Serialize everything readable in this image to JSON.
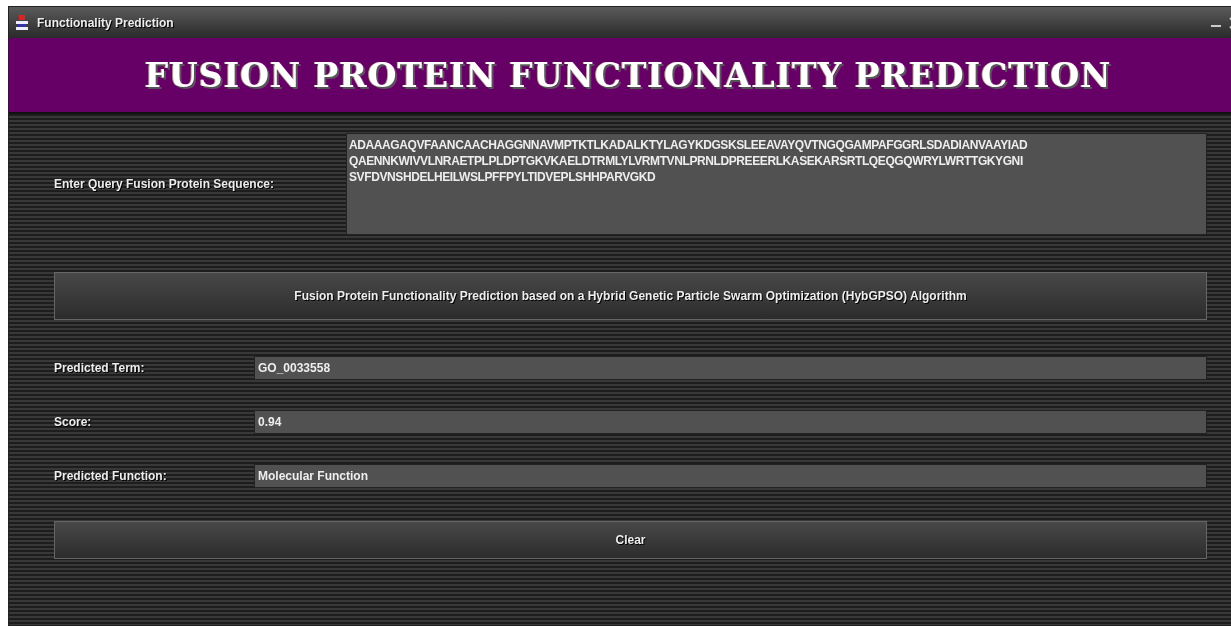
{
  "window": {
    "title": "Functionality Prediction"
  },
  "header": {
    "title": "FUSION PROTEIN FUNCTIONALITY PREDICTION"
  },
  "query": {
    "label": "Enter Query Fusion Protein Sequence:",
    "value_lines": [
      "ADAAAGAQVFAANCAACHAGGNNAVMPTKTLKADALKTYLAGYKDGSKSLEEAVAYQVTNGQGAMPAFGGRLSDADIANVAAYIAD",
      "QAENNKWIVVLNRAETPLPLDPTGKVKAELDTRMLYLVRMTVNLPRNLDPREEERLKASEKARSRTLQEQGQWRYLWRTTGKYGNI",
      "SVFDVNSHDELHEILWSLPFFPYLTIDVEPLSHHPARVGKD"
    ]
  },
  "predict_button": {
    "label": "Fusion Protein Functionality Prediction based on a Hybrid Genetic Particle Swarm Optimization (HybGPSO) Algorithm"
  },
  "results": [
    {
      "label": "Predicted Term:",
      "value": "GO_0033558"
    },
    {
      "label": "Score:",
      "value": "0.94"
    },
    {
      "label": "Predicted Function:",
      "value": "Molecular Function"
    }
  ],
  "clear_button": {
    "label": "Clear"
  }
}
